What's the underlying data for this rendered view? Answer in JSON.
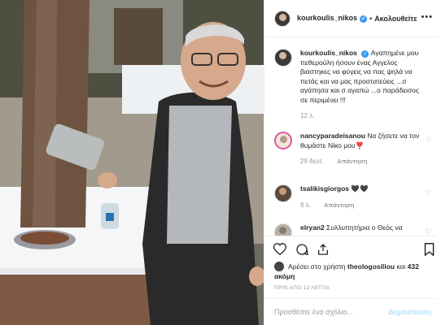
{
  "post": {
    "author": "kourkoulis_nikos",
    "follow_label": "Ακολουθείτε",
    "separator": "•",
    "more_icon": "more-horizontal-icon",
    "caption": {
      "author": "kourkoulis_nikos",
      "text": "Αγαπημένε μου πεθερούλη ήσουν ένας Αγγελος βιαστηκες να φύγεις να πας ψηλά να πετάς και να μας προστατεύεις ...σ αγάπησα και σ αγαπώ ...ο παράδεισος σε περιμένει !!!",
      "age": "12 λ."
    },
    "comments": [
      {
        "user": "nancyparadeisanou",
        "text": "Να ζήσετε να τον θυμάστε Νίκο μου❣️",
        "age": "29 δευτ.",
        "reply_label": "Απάντηση"
      },
      {
        "user": "tsalikisgiorgos",
        "text": "🖤🖤",
        "age": "8 λ.",
        "reply_label": "Απάντηση"
      },
      {
        "user": "elryan2",
        "text": "Συλλυπητήρια ο Θεός να",
        "age": "",
        "reply_label": ""
      }
    ],
    "likes": {
      "prefix": "Αρέσει στο χρήστη",
      "user": "theologosiliou",
      "connector": "και",
      "count": "432 ακόμη"
    },
    "timestamp": "ΠΡΙΝ ΑΠΟ 12 ΛΕΠΤΑ",
    "add_comment": {
      "placeholder": "Προσθέστε ένα σχόλιο...",
      "post_label": "Δημοσίευση"
    },
    "colors": {
      "verified": "#3897f0",
      "post_disabled": "#b2dffc",
      "story_ring": "#e0579d"
    }
  }
}
